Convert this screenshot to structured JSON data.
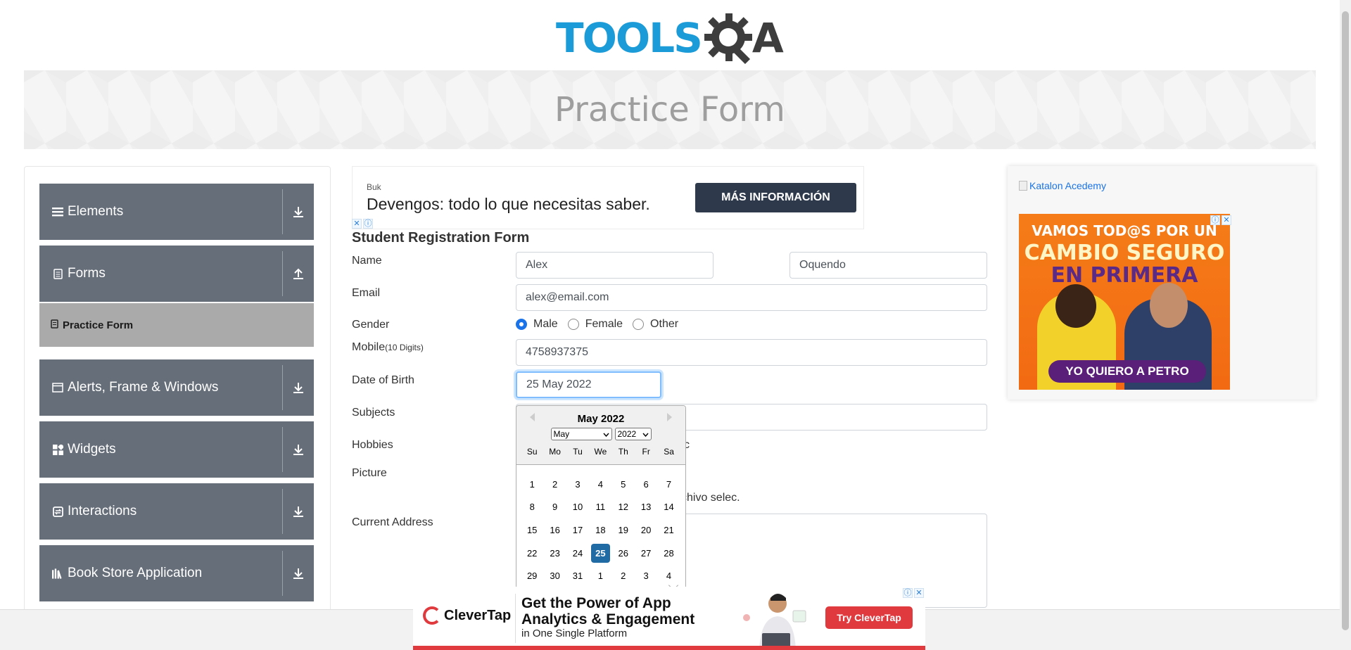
{
  "header": {
    "logo_tools": "TOOLS",
    "logo_a": "A",
    "page_title": "Practice Form"
  },
  "sidebar": {
    "groups": [
      {
        "label": "Elements",
        "icon": "menu-icon",
        "arrow": "download-icon"
      },
      {
        "label": "Forms",
        "icon": "document-icon",
        "arrow": "upload-icon"
      },
      {
        "label": "Alerts, Frame & Windows",
        "icon": "window-icon",
        "arrow": "download-icon"
      },
      {
        "label": "Widgets",
        "icon": "widgets-icon",
        "arrow": "download-icon"
      },
      {
        "label": "Interactions",
        "icon": "interactions-icon",
        "arrow": "download-icon"
      },
      {
        "label": "Book Store Application",
        "icon": "books-icon",
        "arrow": "download-icon"
      }
    ],
    "active_item": "Practice Form"
  },
  "top_ad": {
    "brand": "Buk",
    "headline": "Devengos: todo lo que necesitas saber.",
    "cta": "MÁS INFORMACIÓN"
  },
  "form": {
    "title": "Student Registration Form",
    "labels": {
      "name": "Name",
      "email": "Email",
      "gender": "Gender",
      "mobile": "Mobile",
      "mobile_hint": "(10 Digits)",
      "dob": "Date of Birth",
      "subjects": "Subjects",
      "hobbies": "Hobbies",
      "picture": "Picture",
      "address": "Current Address"
    },
    "first_name": "Alex",
    "last_name": "Oquendo",
    "email": "alex@email.com",
    "gender_options": [
      "Male",
      "Female",
      "Other"
    ],
    "gender_selected": "Male",
    "mobile": "4758937375",
    "dob": "25 May 2022",
    "hobbies_partial": "c",
    "picture_partial": "chivo selec."
  },
  "datepicker": {
    "title": "May 2022",
    "month_select": "May",
    "year_select": "2022",
    "weekdays": [
      "Su",
      "Mo",
      "Tu",
      "We",
      "Th",
      "Fr",
      "Sa"
    ],
    "days": [
      "1",
      "2",
      "3",
      "4",
      "5",
      "6",
      "7",
      "8",
      "9",
      "10",
      "11",
      "12",
      "13",
      "14",
      "15",
      "16",
      "17",
      "18",
      "19",
      "20",
      "21",
      "22",
      "23",
      "24",
      "25",
      "26",
      "27",
      "28",
      "29",
      "30",
      "31",
      "1",
      "2",
      "3",
      "4"
    ],
    "selected_day": "25"
  },
  "right_ad": {
    "broken_image_alt": "Katalon Acedemy",
    "line1": "VAMOS TOD@S POR UN",
    "line2": "CAMBIO SEGURO",
    "line3": "EN PRIMERA",
    "cta": "YO QUIERO A PETRO"
  },
  "bottom_ad": {
    "brand": "CleverTap",
    "headline_1": "Get the Power of App",
    "headline_2": "Analytics & Engagement",
    "subline": "in One Single Platform",
    "cta": "Try CleverTap"
  },
  "colors": {
    "logo_blue": "#1b9bd7",
    "sidebar_group": "#666e79",
    "sidebar_active": "#aaaaaa",
    "datepicker_selected": "#216ba5",
    "focus_border": "#80bdff"
  }
}
